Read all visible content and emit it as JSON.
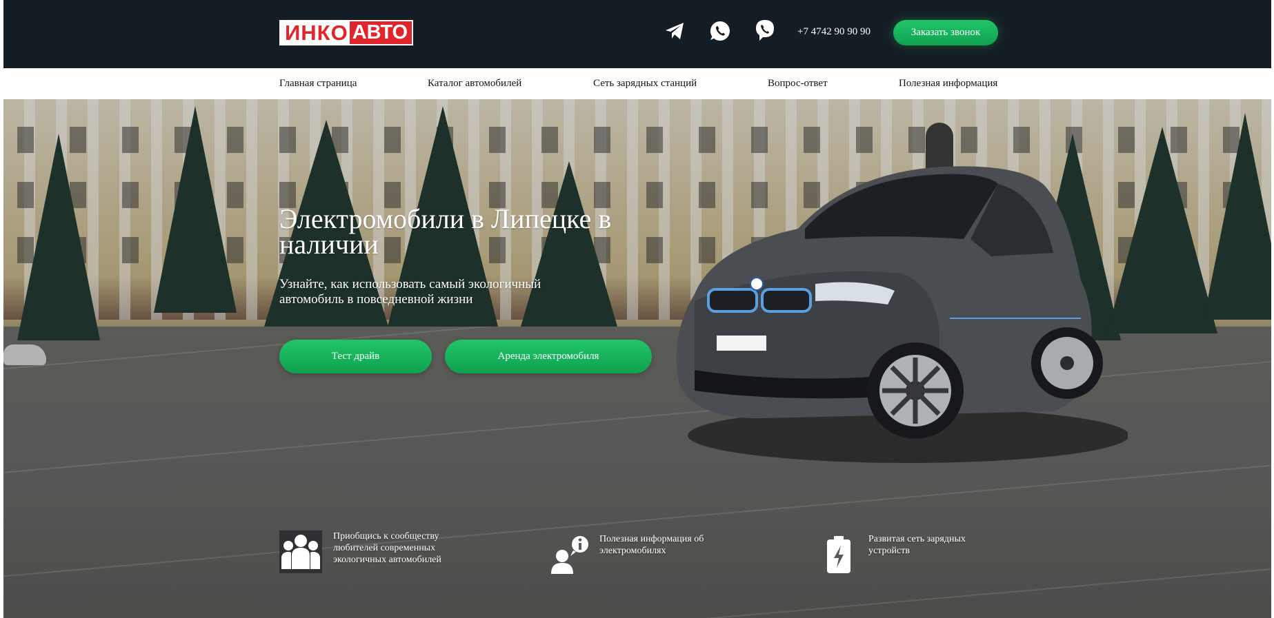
{
  "header": {
    "logo_part1": "ИНКО",
    "logo_part2": "АВТО",
    "phone": "+7 4742 90 90 90",
    "call_button": "Заказать звонок",
    "social_icons": [
      "telegram-icon",
      "whatsapp-icon",
      "viber-icon"
    ]
  },
  "nav": {
    "items": [
      {
        "label": "Главная страница"
      },
      {
        "label": "Каталог автомобилей"
      },
      {
        "label": "Сеть зарядных станций"
      },
      {
        "label": "Вопрос-ответ"
      },
      {
        "label": "Полезная информация"
      }
    ]
  },
  "hero": {
    "title": "Электромобили в Липецке в наличии",
    "subtitle": "Узнайте, как использовать самый экологичный автомобиль в повседневной жизни",
    "buttons": {
      "test_drive": "Тест драйв",
      "rent": "Аренда электромобиля"
    }
  },
  "features": [
    {
      "icon": "community-icon",
      "text": "Приобщись к сообществу любителей современных экологичных автомобилей"
    },
    {
      "icon": "info-person-icon",
      "text": "Полезная информация об электромобилях"
    },
    {
      "icon": "battery-charge-icon",
      "text": "Развитая сеть зарядных устройств"
    }
  ],
  "colors": {
    "header_bg": "#151d24",
    "accent_green": "#1bb35c",
    "logo_red": "#e0262b"
  }
}
